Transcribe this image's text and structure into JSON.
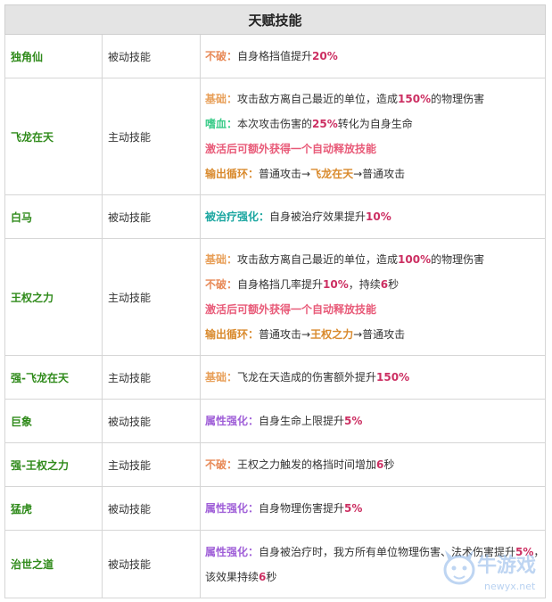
{
  "table": {
    "title": "天赋技能",
    "rows": [
      {
        "name": "独角仙",
        "type": "被动技能",
        "lines": [
          [
            {
              "t": "不破：",
              "c": "#e88a58",
              "b": true
            },
            {
              "t": "自身格挡值提升"
            },
            {
              "t": "20%",
              "c": "#cc2f62",
              "b": true
            }
          ]
        ]
      },
      {
        "name": "飞龙在天",
        "type": "主动技能",
        "lines": [
          [
            {
              "t": "基础：",
              "c": "#e8a05a",
              "b": true
            },
            {
              "t": "攻击敌方离自己最近的单位，造成"
            },
            {
              "t": "150%",
              "c": "#cc2f62",
              "b": true
            },
            {
              "t": "的物理伤害"
            }
          ],
          [
            {
              "t": "嗜血：",
              "c": "#3ccc8a",
              "b": true
            },
            {
              "t": "本次攻击伤害的"
            },
            {
              "t": "25%",
              "c": "#cc2f62",
              "b": true
            },
            {
              "t": "转化为自身生命"
            }
          ],
          [
            {
              "t": "激活后可额外获得一个自动释放技能",
              "c": "#e85a78",
              "b": true
            }
          ],
          [
            {
              "t": "输出循环：",
              "c": "#d98a2d",
              "b": true
            },
            {
              "t": "普通攻击→"
            },
            {
              "t": "飞龙在天",
              "c": "#d98a2d",
              "b": true
            },
            {
              "t": "→普通攻击"
            }
          ]
        ]
      },
      {
        "name": "白马",
        "type": "被动技能",
        "lines": [
          [
            {
              "t": "被治疗强化：",
              "c": "#1aa6a0",
              "b": true
            },
            {
              "t": "自身被治疗效果提升"
            },
            {
              "t": "10%",
              "c": "#cc2f62",
              "b": true
            }
          ]
        ]
      },
      {
        "name": "王权之力",
        "type": "主动技能",
        "lines": [
          [
            {
              "t": "基础：",
              "c": "#e8a05a",
              "b": true
            },
            {
              "t": "攻击敌方离自己最近的单位，造成"
            },
            {
              "t": "100%",
              "c": "#cc2f62",
              "b": true
            },
            {
              "t": "的物理伤害"
            }
          ],
          [
            {
              "t": "不破：",
              "c": "#e88a58",
              "b": true
            },
            {
              "t": "自身格挡几率提升"
            },
            {
              "t": "10%",
              "c": "#cc2f62",
              "b": true
            },
            {
              "t": "，持续"
            },
            {
              "t": "6",
              "c": "#cc2f62",
              "b": true
            },
            {
              "t": "秒"
            }
          ],
          [
            {
              "t": "激活后可额外获得一个自动释放技能",
              "c": "#e85a78",
              "b": true
            }
          ],
          [
            {
              "t": "输出循环：",
              "c": "#d98a2d",
              "b": true
            },
            {
              "t": "普通攻击→"
            },
            {
              "t": "王权之力",
              "c": "#d98a2d",
              "b": true
            },
            {
              "t": "→普通攻击"
            }
          ]
        ]
      },
      {
        "name": "强-飞龙在天",
        "type": "主动技能",
        "lines": [
          [
            {
              "t": "基础：",
              "c": "#e8a05a",
              "b": true
            },
            {
              "t": "飞龙在天造成的伤害额外提升"
            },
            {
              "t": "150%",
              "c": "#cc2f62",
              "b": true
            }
          ]
        ]
      },
      {
        "name": "巨象",
        "type": "被动技能",
        "lines": [
          [
            {
              "t": "属性强化：",
              "c": "#a060d8",
              "b": true
            },
            {
              "t": "自身生命上限提升"
            },
            {
              "t": "5%",
              "c": "#cc2f62",
              "b": true
            }
          ]
        ]
      },
      {
        "name": "强-王权之力",
        "type": "主动技能",
        "lines": [
          [
            {
              "t": "不破：",
              "c": "#e88a58",
              "b": true
            },
            {
              "t": "王权之力触发的格挡时间增加"
            },
            {
              "t": "6",
              "c": "#cc2f62",
              "b": true
            },
            {
              "t": "秒"
            }
          ]
        ]
      },
      {
        "name": "猛虎",
        "type": "被动技能",
        "lines": [
          [
            {
              "t": "属性强化：",
              "c": "#a060d8",
              "b": true
            },
            {
              "t": "自身物理伤害提升"
            },
            {
              "t": "5%",
              "c": "#cc2f62",
              "b": true
            }
          ]
        ]
      },
      {
        "name": "治世之道",
        "type": "被动技能",
        "lines": [
          [
            {
              "t": "属性强化：",
              "c": "#a060d8",
              "b": true
            },
            {
              "t": "自身被治疗时，我方所有单位物理伤害、法术伤害提升"
            },
            {
              "t": "5%",
              "c": "#cc2f62",
              "b": true
            },
            {
              "t": "，"
            }
          ],
          [
            {
              "t": "该效果持续"
            },
            {
              "t": "6",
              "c": "#cc2f62",
              "b": true
            },
            {
              "t": "秒"
            }
          ]
        ]
      }
    ]
  },
  "watermark": {
    "text": "牛游戏",
    "url": "newyx.net",
    "color": "#8ab4e8"
  }
}
